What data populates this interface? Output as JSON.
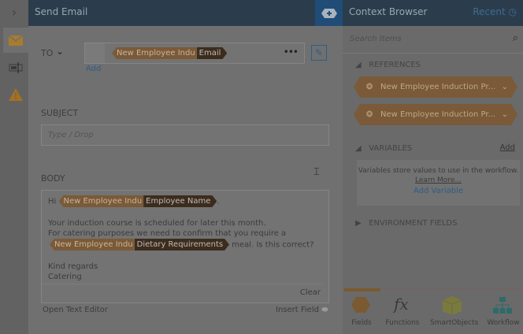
{
  "header": {
    "title": "Send Email"
  },
  "to": {
    "label": "TO",
    "token_source": "New Employee Indu",
    "token_field": "Email",
    "add": "Add"
  },
  "subject": {
    "label": "SUBJECT",
    "placeholder": "Type / Drop"
  },
  "body": {
    "label": "BODY",
    "hi": "Hi",
    "t1_source": "New Employee Indu",
    "t1_field": "Employee Name",
    "dot": ".",
    "line1": "Your induction course is scheduled for later this month.",
    "line2": "For catering purposes we need to confirm that you require a",
    "t2_source": "New Employee Indu",
    "t2_field": "Dietary Requirements",
    "line3": "meal. Is this correct?",
    "line4": "Kind regards",
    "line5": "Catering",
    "clear": "Clear"
  },
  "footer": {
    "open_editor": "Open Text Editor",
    "insert_field": "Insert Field"
  },
  "context": {
    "title": "Context Browser",
    "recent": "Recent",
    "search_placeholder": "Search Items",
    "references_label": "REFERENCES",
    "refs": [
      "New Employee Induction Pr...",
      "New Employee Induction Pr..."
    ],
    "variables_label": "VARIABLES",
    "add": "Add",
    "var_info": "Variables store values to use in the workflow.",
    "learn_more": "Learn More...",
    "add_variable": "Add Variable",
    "env_label": "ENVIRONMENT FIELDS",
    "tabs": [
      "Fields",
      "Functions",
      "SmartObjects",
      "Workflow"
    ]
  }
}
